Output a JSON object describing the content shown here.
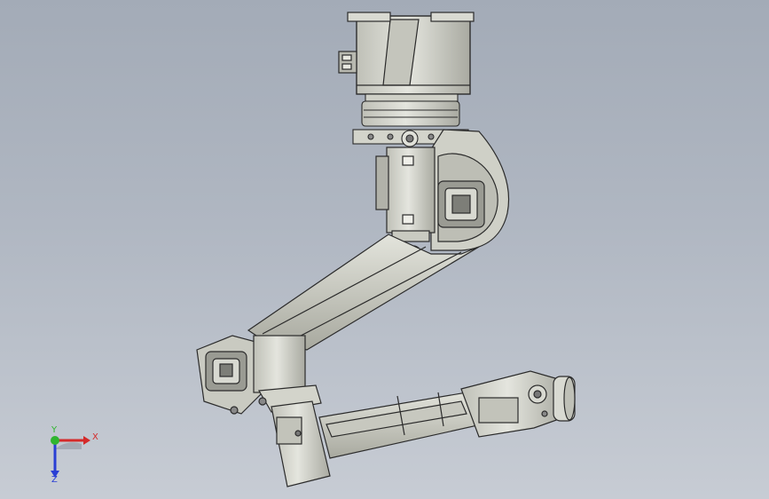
{
  "viewport": {
    "background_top": "#a3abb7",
    "background_bottom": "#c7ccd4",
    "model": "robot-arm-assembly",
    "part_fill": "#d6d7ce",
    "part_stroke": "#2b2b2b"
  },
  "triad": {
    "x_label": "X",
    "y_label": "Y",
    "z_label": "Z",
    "x_color": "#d42a2a",
    "y_color": "#2fb52f",
    "z_color": "#2a3fd4"
  }
}
